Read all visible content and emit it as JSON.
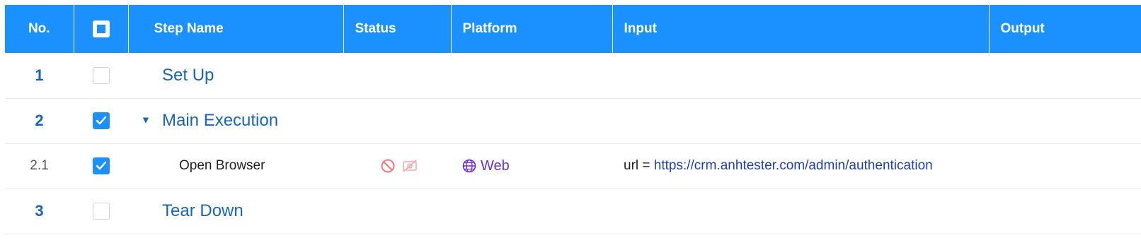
{
  "columns": {
    "no": "No.",
    "step_name": "Step Name",
    "status": "Status",
    "platform": "Platform",
    "input": "Input",
    "output": "Output"
  },
  "rows": [
    {
      "no": "1",
      "name": "Set Up",
      "type": "group",
      "checked": false
    },
    {
      "no": "2",
      "name": "Main Execution",
      "type": "group",
      "checked": true,
      "expanded": true
    },
    {
      "no": "2.1",
      "name": "Open Browser",
      "type": "step",
      "checked": true,
      "status_icons": [
        "block-icon",
        "eye-off-icon"
      ],
      "platform_icon": "globe-icon",
      "platform": "Web",
      "input_key": "url =",
      "input_value": "https://crm.anhtester.com/admin/authentication"
    },
    {
      "no": "3",
      "name": "Tear Down",
      "type": "group",
      "checked": false
    }
  ],
  "colors": {
    "header": "#1b90ff",
    "group_text": "#1565c0",
    "platform": "#6a2fcf",
    "link": "#1e3fb4",
    "status_icon": "#f07a7a"
  }
}
